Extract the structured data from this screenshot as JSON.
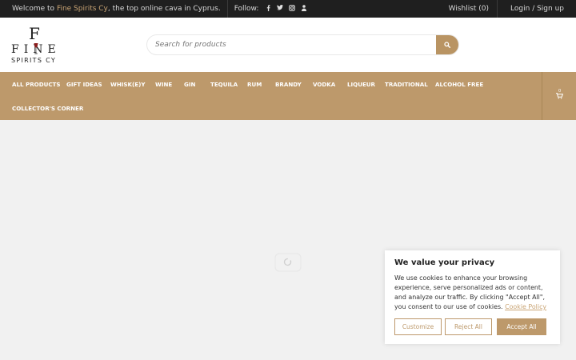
{
  "topbar": {
    "welcome_prefix": "Welcome to ",
    "welcome_brand": "Fine Spirits Cy",
    "welcome_suffix": ", the top online cava in Cyprus.",
    "follow_label": "Follow:",
    "social_icons": [
      "facebook-icon",
      "twitter-icon",
      "instagram-icon",
      "user-icon"
    ],
    "wishlist": "Wishlist (0)",
    "login": "Login / Sign up"
  },
  "logo": {
    "mark": "F",
    "line1": "FINE",
    "line2": "SPIRITS CY"
  },
  "search": {
    "placeholder": "Search for products"
  },
  "nav": {
    "items": [
      "ALL PRODUCTS",
      "GIFT IDEAS",
      "WHISK(E)Y",
      "WINE",
      "GIN",
      "TEQUILA",
      "RUM",
      "BRANDY",
      "VODKA",
      "LIQUEUR",
      "TRADITIONAL",
      "ALCOHOL FREE",
      "COLLECTOR'S CORNER"
    ],
    "cart_count": "0"
  },
  "cookie": {
    "title": "We value your privacy",
    "text": "We use cookies to enhance your browsing experience, serve personalized ads or content, and analyze our traffic. By clicking \"Accept All\", you consent to our use of cookies. ",
    "policy_link": "Cookie Policy",
    "customize": "Customize",
    "reject": "Reject All",
    "accept": "Accept All"
  },
  "colors": {
    "accent": "#bd996b",
    "topbar": "#1f1f1f",
    "brand_text": "#c9a474"
  }
}
